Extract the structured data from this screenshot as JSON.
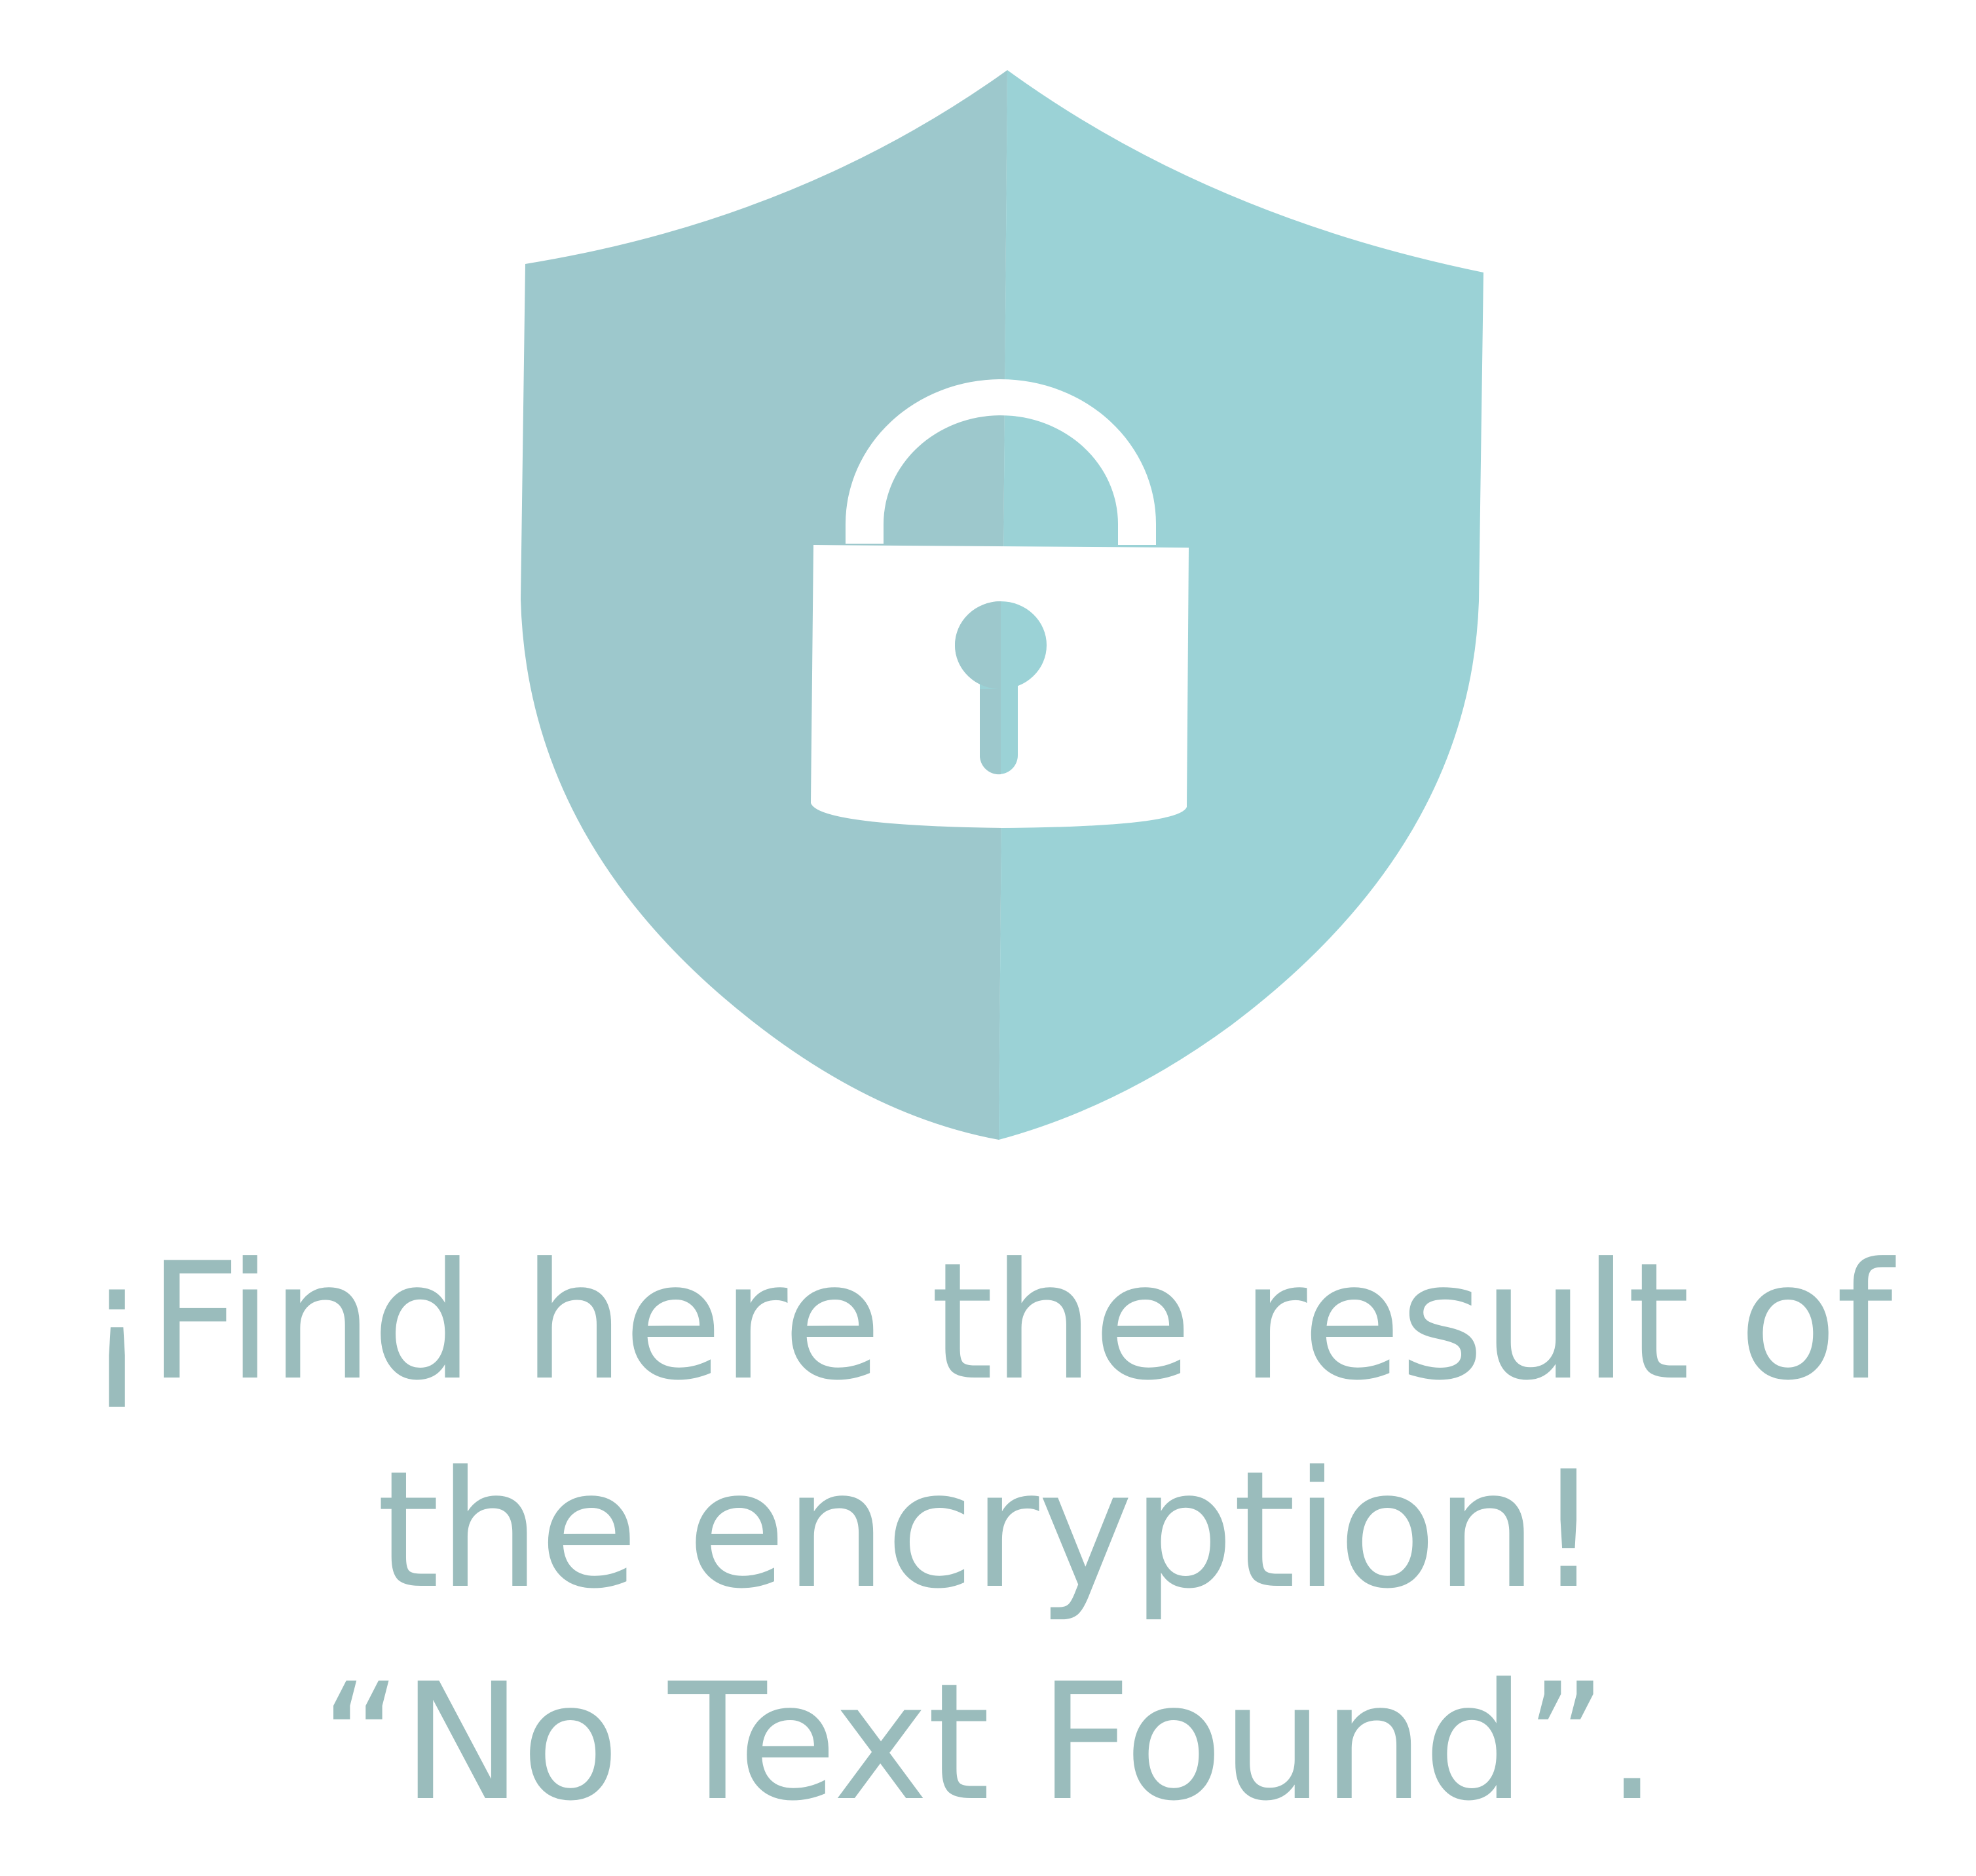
{
  "message": {
    "headline": "¡Find here the result of the encryption!",
    "result": "“No Text Found”."
  },
  "colors": {
    "shield_left": "#9dc8cc",
    "shield_right": "#9bd2d6",
    "lock": "#ffffff",
    "text": "#9abcbc"
  },
  "icons": {
    "shield": "shield-icon",
    "padlock": "padlock-icon",
    "keyhole": "keyhole-icon"
  }
}
